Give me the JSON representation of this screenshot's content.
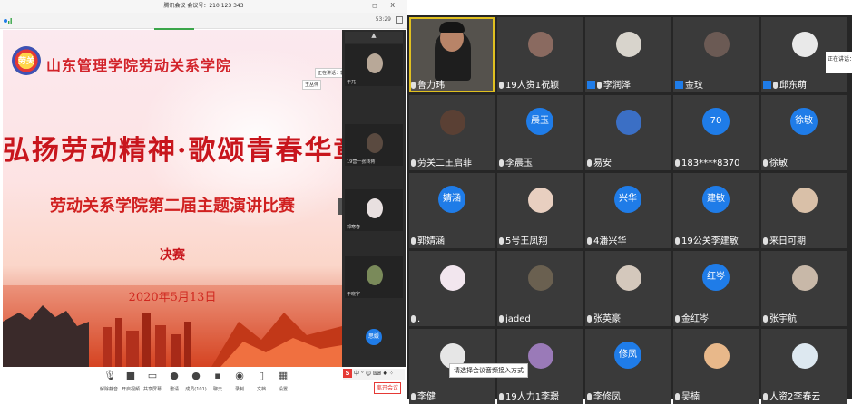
{
  "window": {
    "title": "腾讯会议 会议号：210 123 343",
    "controls": "－ ◻ X",
    "clock": "53:29"
  },
  "slide": {
    "logo_text": "劳关",
    "school": "山东管理学院劳动关系学院",
    "main_title": "弘扬劳动精神·歌颂青春华章",
    "subtitle": "劳动关系学院第二届主题演讲比赛",
    "finals": "决赛",
    "date": "2020年5月13日",
    "speaking_tag": "正在讲话：郭为康",
    "speaker_tag": "王丛伟"
  },
  "strip": {
    "tiles": [
      {
        "name": "于兀"
      },
      {
        "name": "19营一张转蒋"
      },
      {
        "name": "郭寒春"
      },
      {
        "name": "于晓宇"
      }
    ],
    "badge": "思媛"
  },
  "toolbar": {
    "items": [
      {
        "label": "解除静音",
        "icon": "mic-icon"
      },
      {
        "label": "开启视频",
        "icon": "camera-icon"
      },
      {
        "label": "共享屏幕",
        "icon": "share-screen-icon"
      },
      {
        "label": "邀请",
        "icon": "invite-icon"
      },
      {
        "label": "成员(101)",
        "icon": "members-icon"
      },
      {
        "label": "聊天",
        "icon": "chat-icon"
      },
      {
        "label": "录制",
        "icon": "record-icon"
      },
      {
        "label": "文档",
        "icon": "document-icon"
      },
      {
        "label": "设置",
        "icon": "settings-icon"
      }
    ],
    "tray_text": "中 ° ☺ ⌨ ♦ ⁘",
    "leave": "离开会议"
  },
  "gallery": {
    "tiles": [
      {
        "label": "鲁力玮",
        "kind": "video",
        "icon": "mic"
      },
      {
        "label": "19人资1祝颖",
        "kind": "avatar",
        "color": "#8a6a60",
        "icon": "mic"
      },
      {
        "label": "李润泽",
        "kind": "avatar",
        "color": "#d8d4cc",
        "icon": "person-mic"
      },
      {
        "label": "金玟",
        "kind": "avatar",
        "color": "#6b5a54",
        "icon": "person"
      },
      {
        "label": "邱东萌",
        "kind": "avatar",
        "color": "#e9e9e9",
        "icon": "person-mic"
      },
      {
        "label": "劳关二王启菲",
        "kind": "avatar",
        "color": "#5a4034",
        "icon": "mic"
      },
      {
        "label": "李晨玉",
        "kind": "circle",
        "text": "晨玉",
        "icon": "mic"
      },
      {
        "label": "易安",
        "kind": "avatar",
        "color": "#3b6fc5",
        "icon": "mic"
      },
      {
        "label": "183****8370",
        "kind": "circle",
        "text": "70",
        "icon": "mic"
      },
      {
        "label": "徐敏",
        "kind": "circle",
        "text": "徐敏",
        "icon": "mic"
      },
      {
        "label": "郭婧涵",
        "kind": "circle",
        "text": "婧涵",
        "icon": "mic"
      },
      {
        "label": "5号王凤翔",
        "kind": "avatar",
        "color": "#e8cfc0",
        "icon": "mic"
      },
      {
        "label": "4潘兴华",
        "kind": "circle",
        "text": "兴华",
        "icon": "mic"
      },
      {
        "label": "19公关李建敏",
        "kind": "circle",
        "text": "建敏",
        "icon": "mic"
      },
      {
        "label": "来日可期",
        "kind": "avatar",
        "color": "#d9c0a8",
        "icon": "mic"
      },
      {
        "label": ".",
        "kind": "avatar",
        "color": "#f2e6ee",
        "icon": "mic"
      },
      {
        "label": "jaded",
        "kind": "avatar",
        "color": "#6a6050",
        "icon": "mic"
      },
      {
        "label": "张英豪",
        "kind": "avatar",
        "color": "#d4c8bc",
        "icon": "mic"
      },
      {
        "label": "金红岑",
        "kind": "circle",
        "text": "红岑",
        "icon": "mic"
      },
      {
        "label": "张宇航",
        "kind": "avatar",
        "color": "#c8b8a8",
        "icon": "mic"
      },
      {
        "label": "李健",
        "kind": "avatar",
        "color": "#e6e6e6",
        "icon": "mic"
      },
      {
        "label": "19人力1李璟",
        "kind": "avatar",
        "color": "#9a7ab8",
        "icon": "mic"
      },
      {
        "label": "李修凤",
        "kind": "circle",
        "text": "修凤",
        "icon": "mic"
      },
      {
        "label": "吴楠",
        "kind": "avatar",
        "color": "#e8b88a",
        "icon": "mic"
      },
      {
        "label": "人资2李春云",
        "kind": "avatar",
        "color": "#dde8f0",
        "icon": "mic"
      }
    ],
    "speaking_popup": "正在讲话：",
    "tooltip": "请选择会议音频接入方式"
  }
}
